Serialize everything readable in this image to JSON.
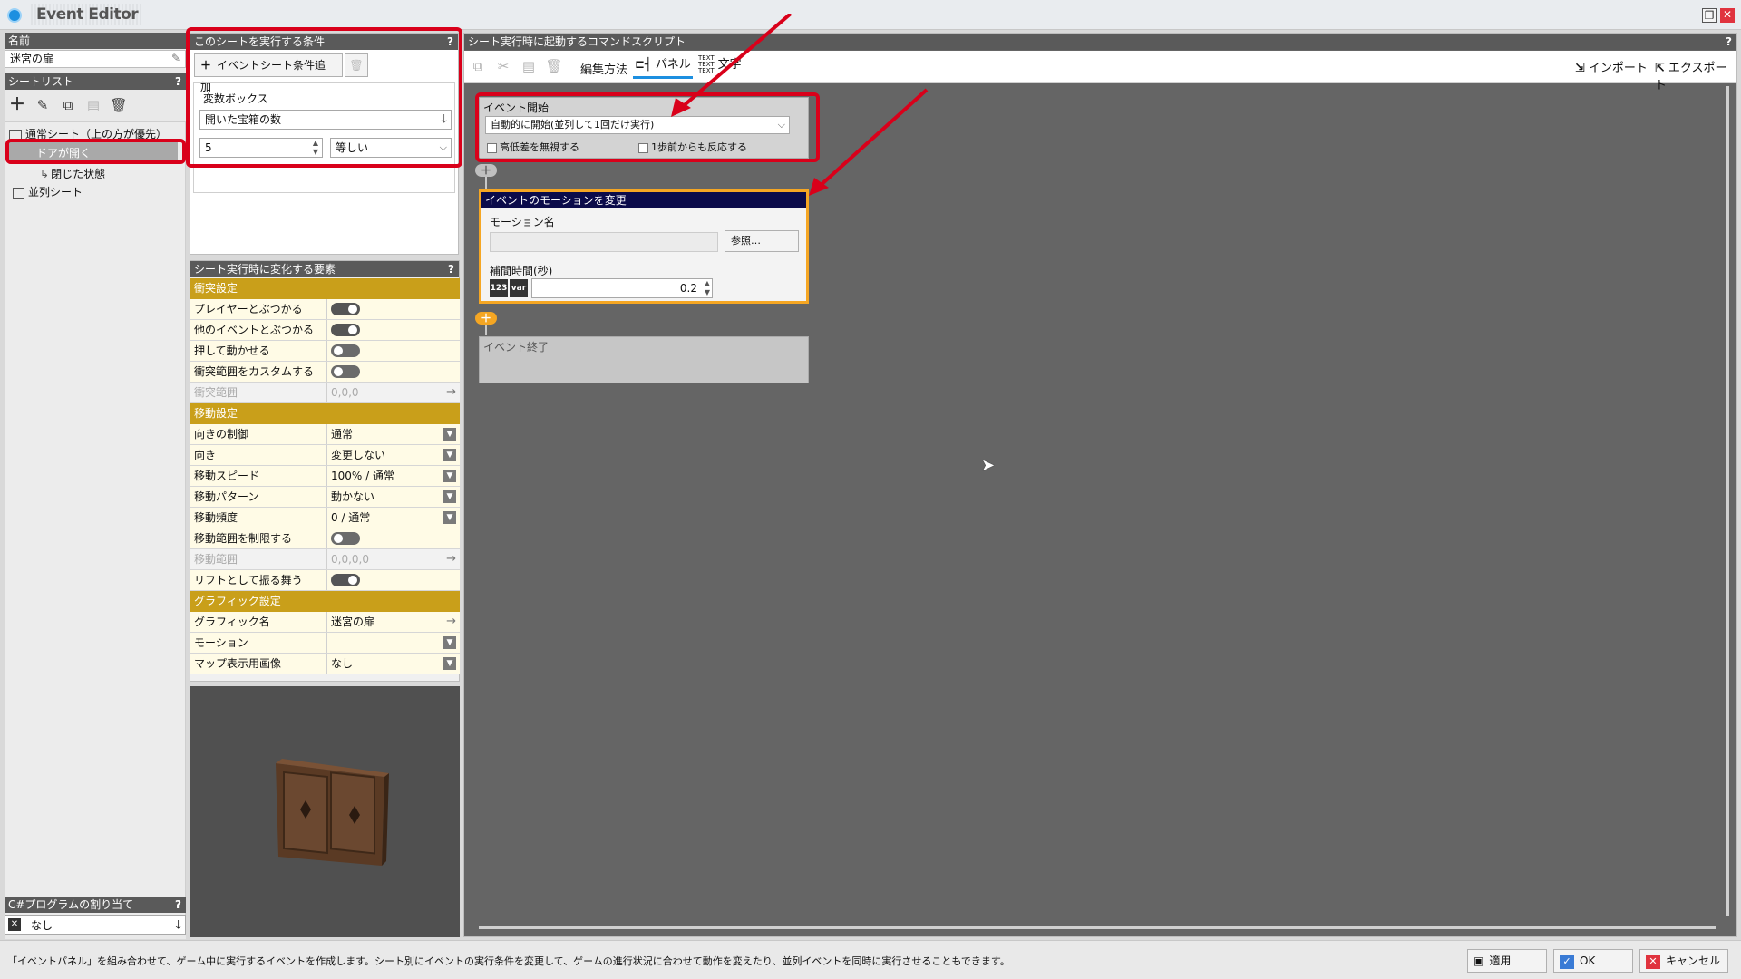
{
  "window": {
    "title": "Event Editor"
  },
  "left": {
    "name_header": "名前",
    "name_value": "迷宮の扉",
    "sheetlist_header": "シートリスト",
    "help": "?",
    "tree": {
      "root": "通常シート（上の方が優先）",
      "item1": "ドアが開く",
      "item2": "閉じた状態",
      "parallel": "並列シート"
    },
    "csharp_header": "C#プログラムの割り当て",
    "csharp_value": "なし"
  },
  "conditions": {
    "header": "このシートを実行する条件",
    "add_button": "イベントシート条件追加",
    "group_label": "変数ボックス",
    "variable": "開いた宝箱の数",
    "number": "5",
    "compare": "等しい"
  },
  "props": {
    "header": "シート実行時に変化する要素",
    "collision_section": "衝突設定",
    "player_collide": "プレイヤーとぶつかる",
    "event_collide": "他のイベントとぶつかる",
    "pushable": "押して動かせる",
    "custom_collision": "衝突範囲をカスタムする",
    "collision_range": "衝突範囲",
    "collision_range_value": "0,0,0",
    "move_section": "移動設定",
    "direction_control": "向きの制御",
    "direction_control_value": "通常",
    "direction": "向き",
    "direction_value": "変更しない",
    "speed": "移動スピード",
    "speed_value": "100% / 通常",
    "pattern": "移動パターン",
    "pattern_value": "動かない",
    "frequency": "移動頻度",
    "frequency_value": "0 / 通常",
    "limit_range": "移動範囲を制限する",
    "move_range": "移動範囲",
    "move_range_value": "0,0,0,0",
    "lift": "リフトとして振る舞う",
    "graphic_section": "グラフィック設定",
    "graphic_name": "グラフィック名",
    "graphic_name_value": "迷宮の扉",
    "motion": "モーション",
    "motion_value": "",
    "map_image": "マップ表示用画像",
    "map_image_value": "なし"
  },
  "script": {
    "header": "シート実行時に起動するコマンドスクリプト",
    "edit_method": "編集方法",
    "panel": "パネル",
    "text": "文字",
    "import": "インポート",
    "export": "エクスポート",
    "event_start": {
      "title": "イベント開始",
      "mode": "自動的に開始(並列して1回だけ実行)",
      "ignore_height": "高低差を無視する",
      "react_before": "1歩前からも反応する"
    },
    "motion_panel": {
      "title": "イベントのモーションを変更",
      "motion_label": "モーション名",
      "browse": "参照…",
      "interp_label": "補間時間(秒)",
      "interp_value": "0.2"
    },
    "event_end": "イベント終了"
  },
  "status": {
    "message": "「イベントパネル」を組み合わせて、ゲーム中に実行するイベントを作成します。シート別にイベントの実行条件を変更して、ゲームの進行状況に合わせて動作を変えたり、並列イベントを同時に実行させることもできます。",
    "apply": "適用",
    "ok": "OK",
    "cancel": "キャンセル"
  },
  "colors": {
    "highlight_red": "#d9001a",
    "section_gold": "#c99f1a",
    "panel_title_navy": "#0b0b4a",
    "accent_orange": "#f5a623"
  }
}
